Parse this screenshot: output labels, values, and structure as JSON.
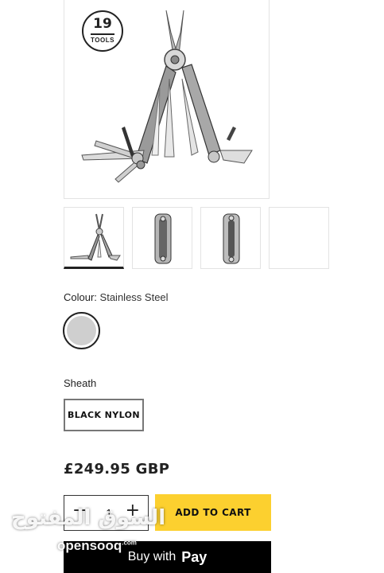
{
  "product": {
    "badge_number": "19",
    "badge_label": "TOOLS",
    "colour_label": "Colour:",
    "colour_value": "Stainless Steel",
    "swatch_color": "#cfcfcf",
    "sheath_label": "Sheath",
    "sheath_option": "BLACK NYLON",
    "price": "£249.95 GBP"
  },
  "cart": {
    "quantity": "1",
    "minus_symbol": "−",
    "plus_symbol": "+",
    "add_to_cart": "ADD TO CART",
    "add_to_cart_color": "#fcd02f"
  },
  "applepay": {
    "buy_with": "Buy with",
    "apple_glyph": "",
    "pay": "Pay"
  },
  "watermark": {
    "arabic": "السوق المفتوح",
    "latin": "opensooq",
    "latin_sup": ".com"
  }
}
